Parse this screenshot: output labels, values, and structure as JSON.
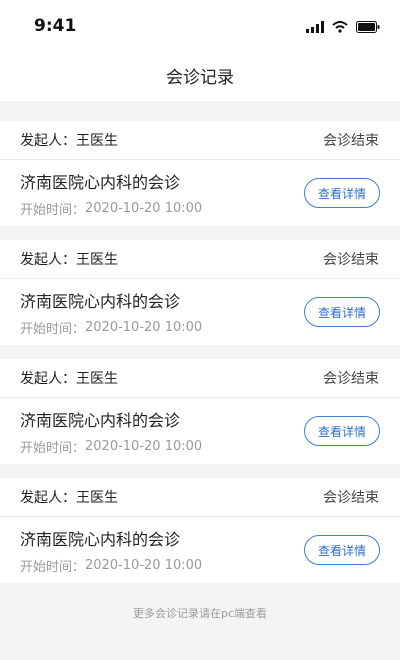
{
  "status_bar": {
    "time": "9:41"
  },
  "nav": {
    "title": "会诊记录"
  },
  "records": [
    {
      "initiator_label": "发起人：",
      "initiator_name": "王医生",
      "status": "会诊结束",
      "title": "济南医院心内科的会诊",
      "time_label": "开始时间：",
      "time_value": "2020-10-20 10:00",
      "button_label": "查看详情"
    },
    {
      "initiator_label": "发起人：",
      "initiator_name": "王医生",
      "status": "会诊结束",
      "title": "济南医院心内科的会诊",
      "time_label": "开始时间：",
      "time_value": "2020-10-20 10:00",
      "button_label": "查看详情"
    },
    {
      "initiator_label": "发起人：",
      "initiator_name": "王医生",
      "status": "会诊结束",
      "title": "济南医院心内科的会诊",
      "time_label": "开始时间：",
      "time_value": "2020-10-20 10:00",
      "button_label": "查看详情"
    },
    {
      "initiator_label": "发起人：",
      "initiator_name": "王医生",
      "status": "会诊结束",
      "title": "济南医院心内科的会诊",
      "time_label": "开始时间：",
      "time_value": "2020-10-20 10:00",
      "button_label": "查看详情"
    }
  ],
  "footer": {
    "note": "更多会诊记录请在pc端查看"
  },
  "icons": {
    "signal": "cellular-signal-icon",
    "wifi": "wifi-icon",
    "battery": "battery-icon"
  },
  "colors": {
    "accent": "#3c7fd6",
    "background": "#f4f4f4",
    "secondary_text": "#9a9a9a"
  }
}
